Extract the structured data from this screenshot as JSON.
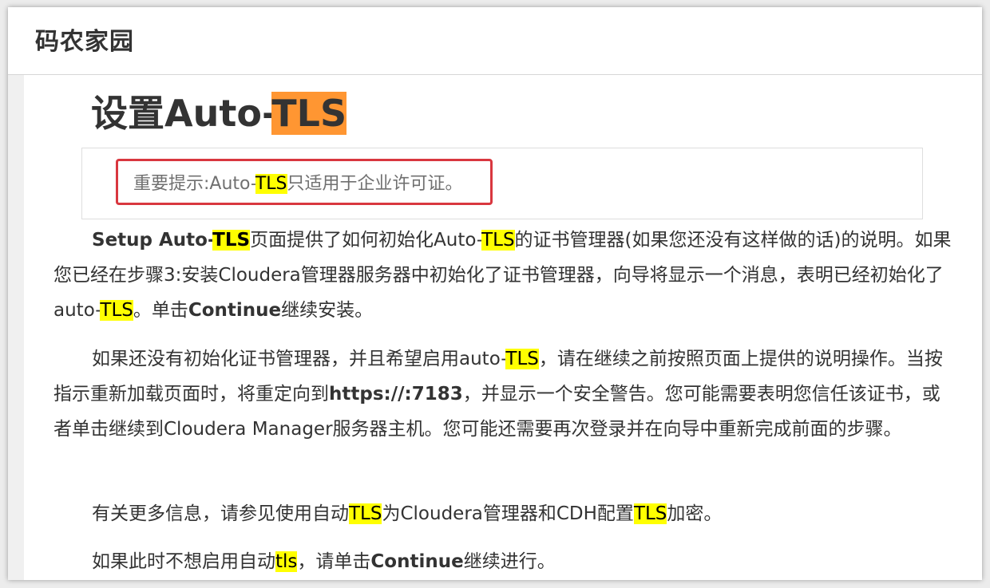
{
  "site": {
    "title": "码农家园"
  },
  "article": {
    "heading": {
      "text": "设置Auto-",
      "highlight": "TLS"
    },
    "note": {
      "pre": "重要提示:Auto-",
      "hl": "TLS",
      "post": "只适用于企业许可证。"
    },
    "p1": {
      "b1": "Setup Auto-",
      "hl1": "TLS",
      "t1": "页面提供了如何初始化Auto-",
      "hl2": "TLS",
      "t2": "的证书管理器(如果您还没有这样做的话)的说明。如果您已经在步骤3:安装Cloudera管理器服务器中初始化了证书管理器，向导将显示一个消息，表明已经初始化了auto-",
      "hl3": "TLS",
      "t3": "。单击",
      "b2": "Continue",
      "t4": "继续安装。"
    },
    "p2": {
      "t1": "如果还没有初始化证书管理器，并且希望启用auto-",
      "hl1": "TLS",
      "t2": "，请在继续之前按照页面上提供的说明操作。当按指示重新加载页面时，将重定向到",
      "b1": "https://:7183",
      "t3": "，并显示一个安全警告。您可能需要表明您信任该证书，或者单击继续到Cloudera Manager服务器主机。您可能还需要再次登录并在向导中重新完成前面的步骤。"
    },
    "p3": {
      "t1": "有关更多信息，请参见使用自动",
      "hl1": "TLS",
      "t2": "为Cloudera管理器和CDH配置",
      "hl2": "TLS",
      "t3": "加密。"
    },
    "p4": {
      "t1": "如果此时不想启用自动",
      "hl1": "tls",
      "t2": "，请单击",
      "b1": "Continue",
      "t3": "继续进行。"
    }
  },
  "colors": {
    "heading_highlight": "#ff9632",
    "text_highlight": "#ffff00",
    "note_border": "#d9373f"
  }
}
